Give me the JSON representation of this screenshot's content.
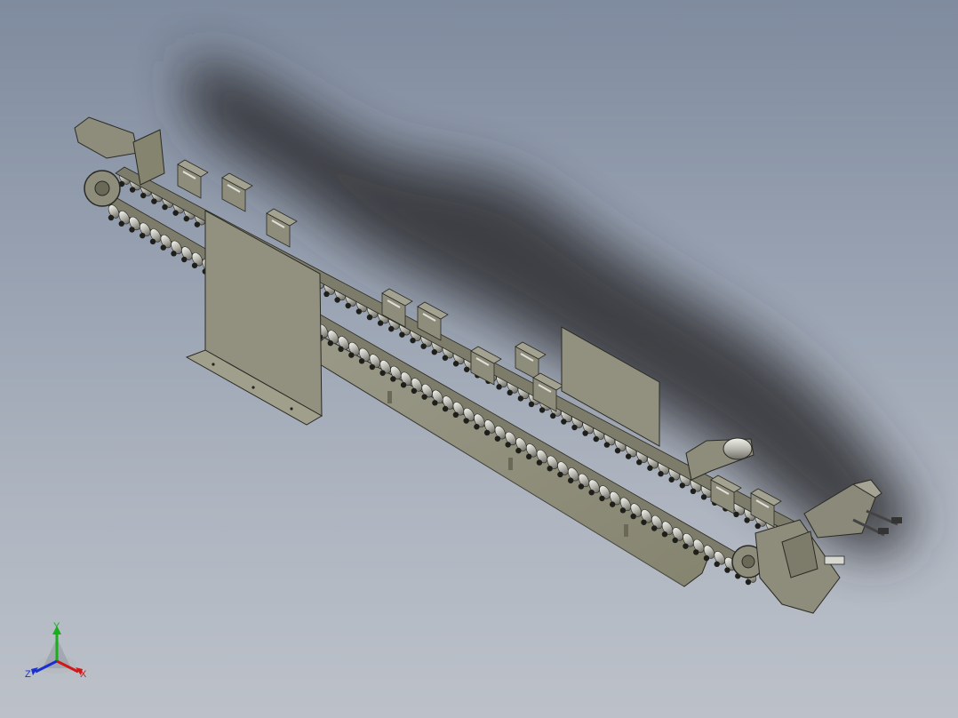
{
  "viewport": {
    "background_top": "#7f8b9e",
    "background_bottom": "#bcc1c9",
    "model_color": "#8e8d7c",
    "edge_color": "#2a2a24",
    "roller_color": "#d8d8d2",
    "shadow_color": "#2e2e30"
  },
  "triad": {
    "x_label": "X",
    "y_label": "Y",
    "z_label": "Z",
    "x_color": "#d01818",
    "y_color": "#18b018",
    "z_color": "#1830d0"
  }
}
